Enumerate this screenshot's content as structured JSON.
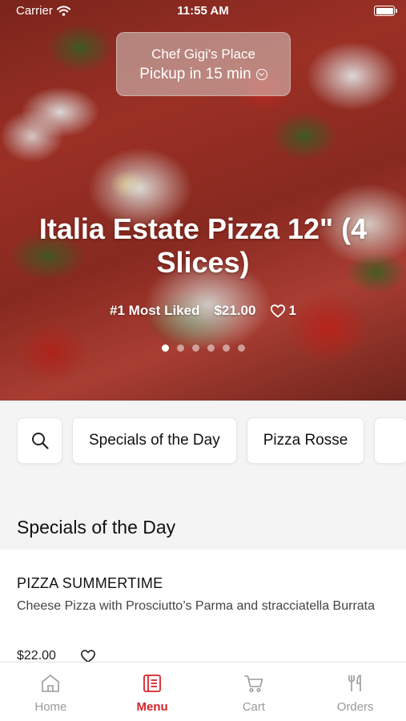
{
  "status_bar": {
    "carrier": "Carrier",
    "time": "11:55 AM"
  },
  "location": {
    "name": "Chef Gigi's Place",
    "pickup": "Pickup in 15 min"
  },
  "featured": {
    "title": "Italia Estate Pizza 12\" (4 Slices)",
    "badge": "#1 Most Liked",
    "price": "$21.00",
    "likes": "1",
    "slide_count": 6,
    "active_slide": 1
  },
  "categories": [
    "Specials of the Day",
    "Pizza Rosse"
  ],
  "section": {
    "title": "Specials of the Day"
  },
  "item": {
    "name": "PIZZA SUMMERTIME",
    "description": "Cheese Pizza with Prosciutto’s Parma and stracciatella Burrata",
    "price": "$22.00"
  },
  "tabs": [
    {
      "label": "Home",
      "icon": "home-icon"
    },
    {
      "label": "Menu",
      "icon": "menu-icon"
    },
    {
      "label": "Cart",
      "icon": "cart-icon"
    },
    {
      "label": "Orders",
      "icon": "orders-icon"
    }
  ],
  "colors": {
    "accent": "#d8232a",
    "inactive_tab": "#9a9a9a"
  }
}
